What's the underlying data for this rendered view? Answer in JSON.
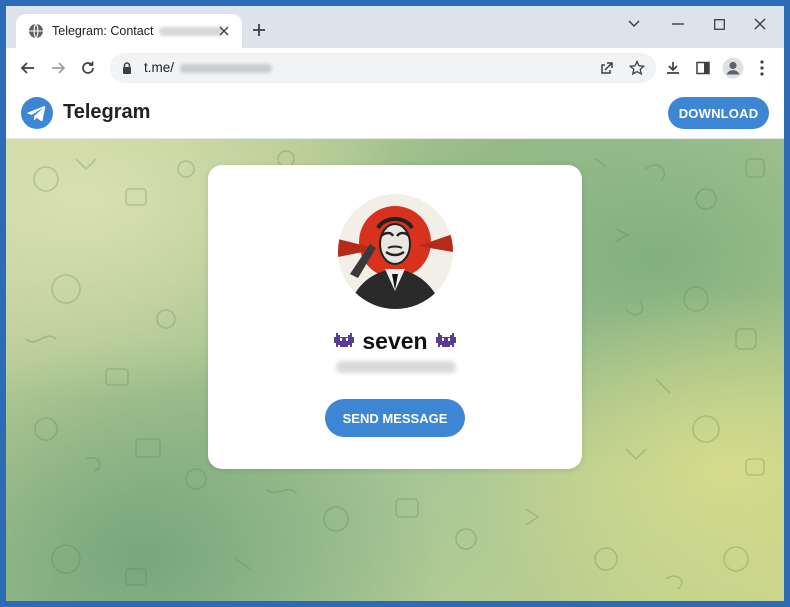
{
  "browser": {
    "tab_title": "Telegram: Contact",
    "address": "t.me/",
    "new_tab_symbol": "+"
  },
  "page": {
    "brand": "Telegram",
    "download_label": "DOWNLOAD",
    "contact_name": "seven",
    "send_label": "SEND MESSAGE"
  },
  "icons": {
    "favicon": "globe-icon",
    "contact_emoji": "alien-monster-icon"
  },
  "colors": {
    "accent": "#3d86d4",
    "window_frame": "#2c6bb5",
    "tabstrip": "#dde3ea",
    "background_green": "#a8c796",
    "background_yellow": "#c9d59a"
  }
}
